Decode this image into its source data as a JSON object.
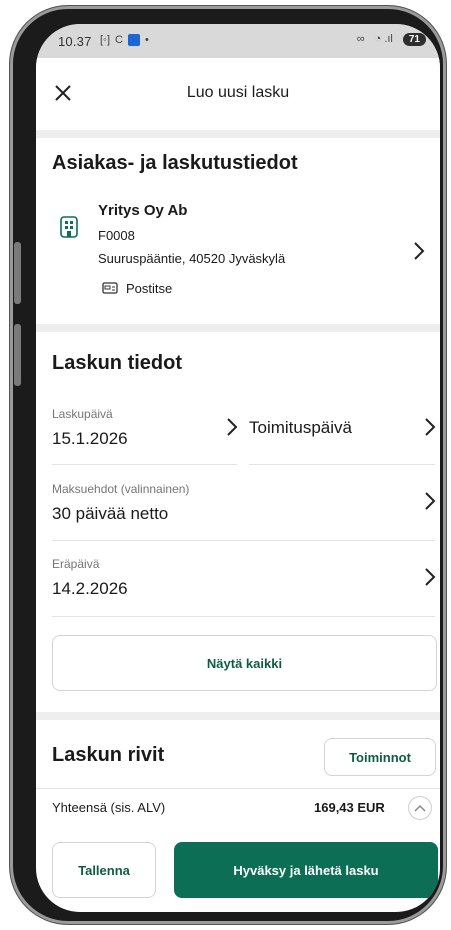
{
  "status_bar": {
    "time": "10.37",
    "battery": "71"
  },
  "header": {
    "title": "Luo uusi lasku"
  },
  "customer_section": {
    "title": "Asiakas- ja laskutustiedot",
    "name": "Yritys Oy Ab",
    "code": "F0008",
    "address": "Suuruspääntie, 40520 Jyväskylä",
    "delivery_method": "Postitse"
  },
  "invoice_section": {
    "title": "Laskun tiedot",
    "invoice_date_label": "Laskupäivä",
    "invoice_date_value": "15.1.2026",
    "delivery_date_label": "Toimituspäivä",
    "payment_terms_label": "Maksuehdot (valinnainen)",
    "payment_terms_value": "30 päivää netto",
    "due_date_label": "Eräpäivä",
    "due_date_value": "14.2.2026",
    "show_all_button": "Näytä kaikki"
  },
  "rows_section": {
    "title": "Laskun rivit",
    "actions_button": "Toiminnot"
  },
  "footer": {
    "total_label": "Yhteensä (sis. ALV)",
    "total_value": "169,43 EUR",
    "save_button": "Tallenna",
    "approve_send_button": "Hyväksy ja lähetä lasku"
  },
  "colors": {
    "primary": "#0b6e55",
    "primary_text": "#0f5c45"
  }
}
